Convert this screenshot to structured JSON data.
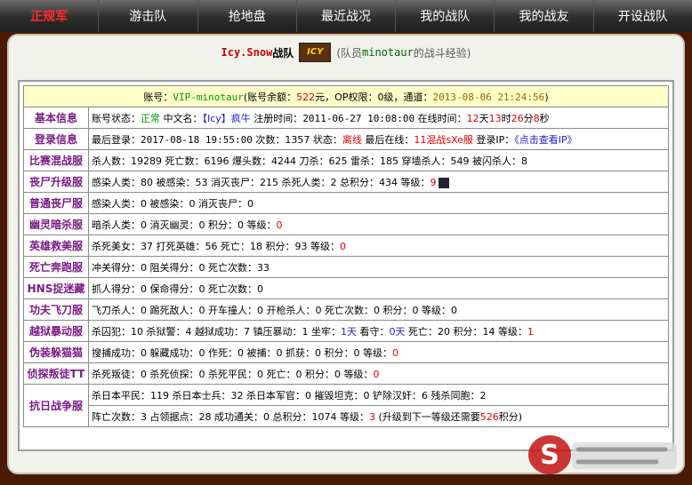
{
  "nav": {
    "items": [
      "正规军",
      "游击队",
      "抢地盘",
      "最近战况",
      "我的战队",
      "我的战友",
      "开设战队"
    ]
  },
  "header": {
    "clan_prefix": "Icy.Snow",
    "clan_suffix": "战队",
    "logo_text": "ICY",
    "member_pre": "(队员",
    "member_name": "minotaur",
    "member_post": "的战斗经验)"
  },
  "account": {
    "pre": "账号：",
    "name": "VIP-minotaur",
    "bal_pre": "(账号余额：",
    "balance": "522",
    "bal_post": "元，OP权限：0级，通道：",
    "datetime": "2013-08-06 21:24:56",
    "close": ")"
  },
  "rows": {
    "basic": {
      "label": "基本信息",
      "status_label": "账号状态：",
      "status": "正常",
      "cn_label": " 中文名：",
      "cn_name": "【Icy】疯牛",
      "reg_label": " 注册时间：",
      "reg_time": "2011-06-27 10:08:00",
      "online_label": " 在线时间：",
      "d": "12",
      "d_u": "天",
      "h": "13",
      "h_u": "时",
      "m": "26",
      "m_u": "分",
      "s": "8",
      "s_u": "秒"
    },
    "login": {
      "label": "登录信息",
      "last_label": "最后登录：",
      "last_time": "2017-08-18 19:55:00",
      "count_label": " 次数：",
      "count": "1357",
      "state_label": " 状态：",
      "state": "离线",
      "where_label": " 最后在线：",
      "where": "11混战sXe服",
      "ip_label": " 登录IP：",
      "ip_link": "《点击查看IP》"
    },
    "match": {
      "label": "比赛混战服",
      "text": "杀人数：19289 死亡数：6196 爆头数：4244 刀杀：625 雷杀：185 穿墙杀人：549 被闪杀人：8"
    },
    "zombie": {
      "label": "丧尸升级服",
      "text": "感染人类：80 被感染：53 消灭丧尸：215 杀死人类：2 总积分：434 等级：",
      "level": "9"
    },
    "normal_zombie": {
      "label": "普通丧尸服",
      "text": "感染人类：0 被感染：0 消灭丧尸：0"
    },
    "ghost": {
      "label": "幽灵暗杀服",
      "text": "暗杀人类：0 消灭幽灵：0 积分：0 等级：",
      "level": "0"
    },
    "hero": {
      "label": "英雄救美服",
      "text": "杀死美女：37 打死英雄：56 死亡：18 积分：93 等级：",
      "level": "0"
    },
    "deathrun": {
      "label": "死亡奔跑服",
      "text": "冲关得分：0 阻关得分：0 死亡次数：33"
    },
    "hns": {
      "label": "HNS捉迷藏",
      "text": "抓人得分：0 保命得分：0 死亡次数：0"
    },
    "kungfu": {
      "label": "功夫飞刀服",
      "text": "飞刀杀人：0 踢死敌人：0 开车撞人：0 开枪杀人：0 死亡次数：0 积分：0 等级：0"
    },
    "jail": {
      "label": "越狱暴动服",
      "text_pre": "杀囚犯：10 杀狱警：4 越狱成功：7 镇压暴动：1 坐牢：",
      "jail_time": "1天",
      "guard_label": " 看守：",
      "guard_time": "0天",
      "text_post": " 死亡：20 积分：14 等级：",
      "level": "1"
    },
    "hide": {
      "label": "伪装躲猫猫",
      "text": "搜捕成功：0 躲藏成功：0 作死：0 被捕：0 抓获：0 积分：0 等级：",
      "level": "0"
    },
    "renegade": {
      "label": "侦探叛徒TT",
      "text": "杀死叛徒：0 杀死侦探：0 杀死平民：0 死亡：0 积分：0 等级：",
      "level": "0"
    },
    "war": {
      "label": "抗日战争服",
      "line1": "杀日本平民：119 杀日本士兵：32 杀日本军官：0 摧毁坦克：0 铲除汉奸：6 残杀同胞：2",
      "line2_pre": "阵亡次数：3 占领据点：28 成功通关：0 总积分：1074 等级：",
      "level": "3",
      "line2_mid": " (升级到下一等级还需要",
      "need": "526",
      "line2_post": "积分)"
    }
  },
  "colors": {
    "nav_active": "#ff2a2a",
    "label_purple": "#7a1a86",
    "highlight_yellow": "#ffffc8",
    "frame_bg": "#4a1a06"
  }
}
